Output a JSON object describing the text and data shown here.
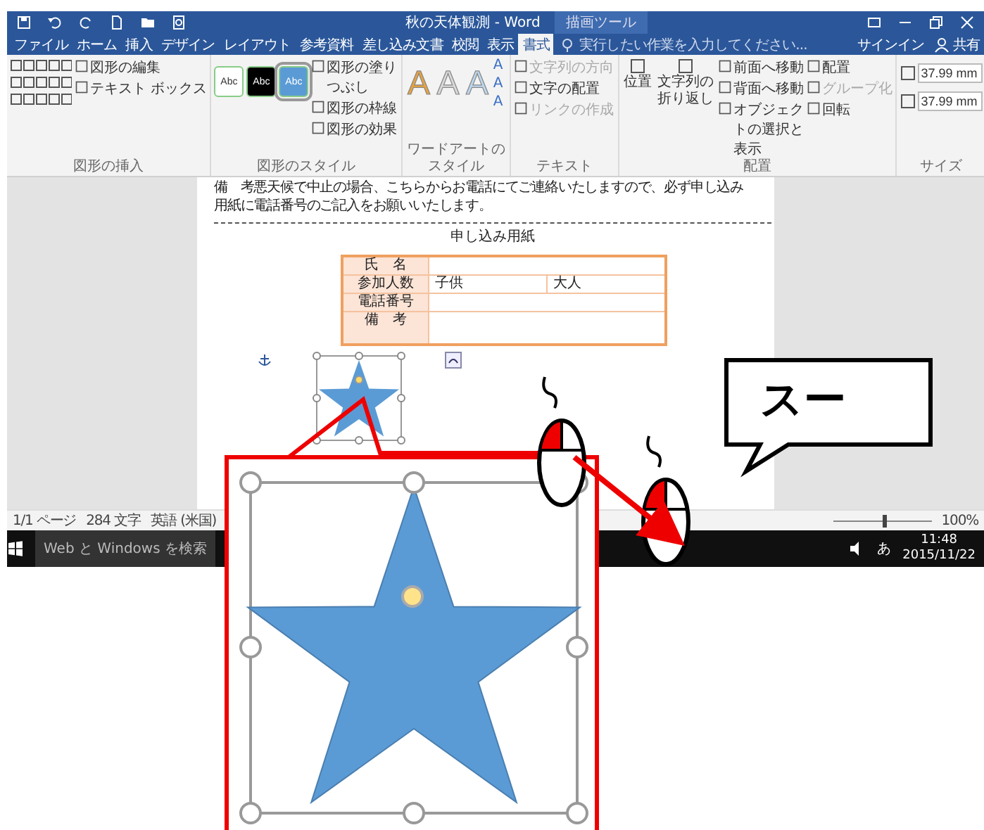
{
  "window": {
    "title": "秋の天体観測 - Word",
    "context_tab_group": "描画ツール"
  },
  "tabs": [
    {
      "label": "ファイル",
      "selected": false
    },
    {
      "label": "ホーム",
      "selected": false
    },
    {
      "label": "挿入",
      "selected": false
    },
    {
      "label": "デザイン",
      "selected": false
    },
    {
      "label": "レイアウト",
      "selected": false
    },
    {
      "label": "参考資料",
      "selected": false
    },
    {
      "label": "差し込み文書",
      "selected": false
    },
    {
      "label": "校閲",
      "selected": false
    },
    {
      "label": "表示",
      "selected": false
    },
    {
      "label": "書式",
      "selected": true
    }
  ],
  "tell_me": {
    "placeholder": "実行したい作業を入力してください..."
  },
  "account": {
    "sign_in": "サインイン",
    "share": "共有"
  },
  "ribbon_groups": [
    {
      "kind": "insert_shapes",
      "label": "図形の挿入",
      "commands": [
        {
          "label": "図形の編集",
          "disabled": false
        },
        {
          "label": "テキスト ボックス",
          "disabled": false
        }
      ]
    },
    {
      "kind": "shape_styles",
      "label": "図形のスタイル",
      "swatches": [
        {
          "label": "Abc",
          "color": "#ffffff",
          "selected": false
        },
        {
          "label": "Abc",
          "color": "#000000",
          "selected": false
        },
        {
          "label": "Abc",
          "color": "#5b9bd5",
          "selected": true
        }
      ],
      "commands": [
        {
          "label": "図形の塗りつぶし",
          "disabled": false
        },
        {
          "label": "図形の枠線",
          "disabled": false
        },
        {
          "label": "図形の効果",
          "disabled": false
        }
      ]
    },
    {
      "kind": "wordart_styles",
      "label": "ワードアートのスタイル",
      "samples": [
        {
          "label": "A",
          "color": "#e9a33c"
        },
        {
          "label": "A",
          "color": "#d9d9d9"
        },
        {
          "label": "A",
          "color": "#bdd7ee"
        }
      ],
      "effects": [
        "A",
        "A",
        "A"
      ]
    },
    {
      "kind": "text",
      "label": "テキスト",
      "commands": [
        {
          "label": "文字列の方向",
          "disabled": true
        },
        {
          "label": "文字の配置",
          "disabled": false
        },
        {
          "label": "リンクの作成",
          "disabled": true
        }
      ]
    },
    {
      "kind": "arrange",
      "label": "配置",
      "large": [
        "位置",
        "文字列の折り返し"
      ],
      "commands": [
        {
          "label": "前面へ移動",
          "disabled": false
        },
        {
          "label": "背面へ移動",
          "disabled": false
        },
        {
          "label": "オブジェクトの選択と表示",
          "disabled": false
        },
        {
          "label": "配置",
          "disabled": false
        },
        {
          "label": "グループ化",
          "disabled": true
        },
        {
          "label": "回転",
          "disabled": false
        }
      ]
    },
    {
      "kind": "size",
      "label": "サイズ",
      "fields": [
        "37.99 mm",
        "37.99 mm"
      ]
    }
  ],
  "document": {
    "paragraphs": [
      "備　考悪天候で中止の場合、こちらからお電話にてご連絡いたしますので、必ず申し込み",
      "用紙に電話番号のご記入をお願いいたします。"
    ],
    "form_title": "申し込み用紙",
    "table": {
      "rows": [
        {
          "label": "氏　名"
        },
        {
          "label": "参加人数",
          "cells": [
            "子供",
            "大人"
          ]
        },
        {
          "label": "電話番号"
        },
        {
          "label": "備　考"
        }
      ]
    }
  },
  "status_bar": {
    "page": "1/1 ページ",
    "words": "284 文字",
    "language": "英語 (米国)",
    "zoom": "100%",
    "zoom_level": {
      "level": 0.5
    }
  },
  "taskbar": {
    "search": {
      "placeholder": "Web と Windows を検索"
    },
    "ime": "あ",
    "time": "11:48",
    "date": "2015/11/22"
  },
  "annotation": {
    "bubble": "スー"
  }
}
